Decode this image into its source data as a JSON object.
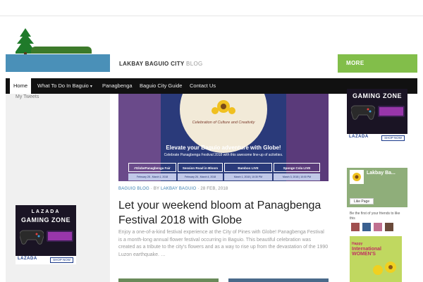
{
  "header": {
    "site_title_bold": "LAKBAY BAGUIO CITY",
    "site_title_light": " BLOG",
    "more_label": "MORE"
  },
  "nav": {
    "items": [
      {
        "label": "Home"
      },
      {
        "label": "What To Do In Baguio"
      },
      {
        "label": "Panagbenga"
      },
      {
        "label": "Baguio City Guide"
      },
      {
        "label": "Contact Us"
      }
    ],
    "dropdown_caret": "▾"
  },
  "sidebar_left": {
    "tweets_label": "My Tweets",
    "ad": {
      "brand": "LAZADA",
      "zone": "GAMING ZONE",
      "logo": "LAZADA",
      "cta": "SHOP NOW"
    }
  },
  "hero": {
    "tagline": "Celebration of Culture and Creativity",
    "headline": "Elevate your Baguio adventure with Globe!",
    "subline": "Celebrate Panagbenga Festival 2018 with this awesome line-up of activities.",
    "events": [
      {
        "name": "#GlobePanagbenga Fair",
        "date": "February 28 - March 1, 2018"
      },
      {
        "name": "Session Road in Bloom",
        "date": "February 26 - March 4, 2018"
      },
      {
        "name": "Bamboo LIVE",
        "date": "March 1, 2018 | 10:30 PM"
      },
      {
        "name": "Sponge Cola LIVE",
        "date": "March 3, 2018 | 10:00 PM"
      }
    ]
  },
  "post": {
    "category": "BAGUIO BLOG",
    "by": " · BY ",
    "author": "LAKBAY BAGUIO",
    "date": " · 28 FEB, 2018",
    "title": "Let your weekend bloom at Panagbenga Festival 2018 with Globe",
    "excerpt": "Enjoy a one-of-a-kind festival experience at the City of Pines with Globe! Panagbenga Festival is a month-long annual flower festival occurring in Baguio. This beautiful celebration was created as a tribute to the city’s flowers and as a way to rise up from the devastation of the 1990 Luzon earthquake. …"
  },
  "sidebar_right": {
    "ad": {
      "zone": "GAMING ZONE",
      "logo": "LAZADA",
      "cta": "SHOP NOW"
    },
    "facebook": {
      "page_name": "Lakbay Ba...",
      "like_label": "Like Page",
      "friends_text": "Be the first of your friends to like this",
      "women_small": "Happy",
      "women_big": "International WOMEN'S"
    }
  },
  "colors": {
    "accent_green": "#82be4a",
    "nav_bg": "#111111",
    "link_blue": "#3a7fb0"
  }
}
